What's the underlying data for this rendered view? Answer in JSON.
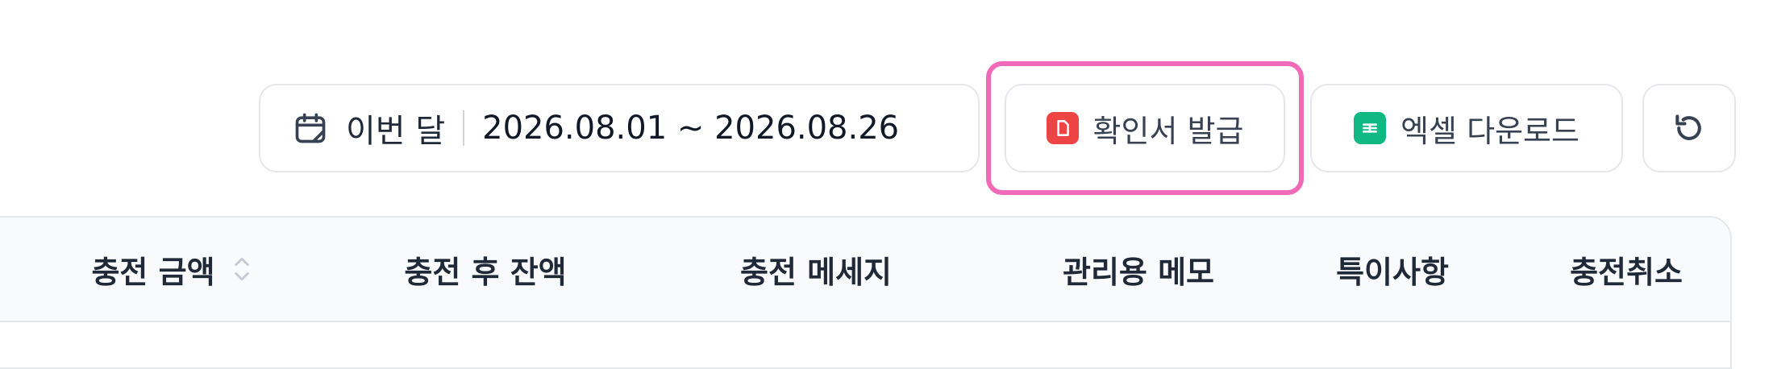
{
  "toolbar": {
    "date_range": {
      "label": "이번 달",
      "value": "2026.08.01 ~ 2026.08.26"
    },
    "confirm_button_label": "확인서 발급",
    "excel_button_label": "엑셀 다운로드",
    "refresh_icon": "refresh-icon",
    "calendar_icon": "calendar-icon",
    "document_icon": "document-icon",
    "spreadsheet_icon": "spreadsheet-icon",
    "highlight_color": "#f06ab8",
    "document_icon_color": "#ef4444",
    "spreadsheet_icon_color": "#10b981"
  },
  "table": {
    "columns": [
      {
        "label": "충전 금액",
        "sortable": true
      },
      {
        "label": "충전 후 잔액",
        "sortable": false
      },
      {
        "label": "충전 메세지",
        "sortable": false
      },
      {
        "label": "관리용 메모",
        "sortable": false
      },
      {
        "label": "특이사항",
        "sortable": false
      },
      {
        "label": "충전취소",
        "sortable": false
      }
    ]
  }
}
